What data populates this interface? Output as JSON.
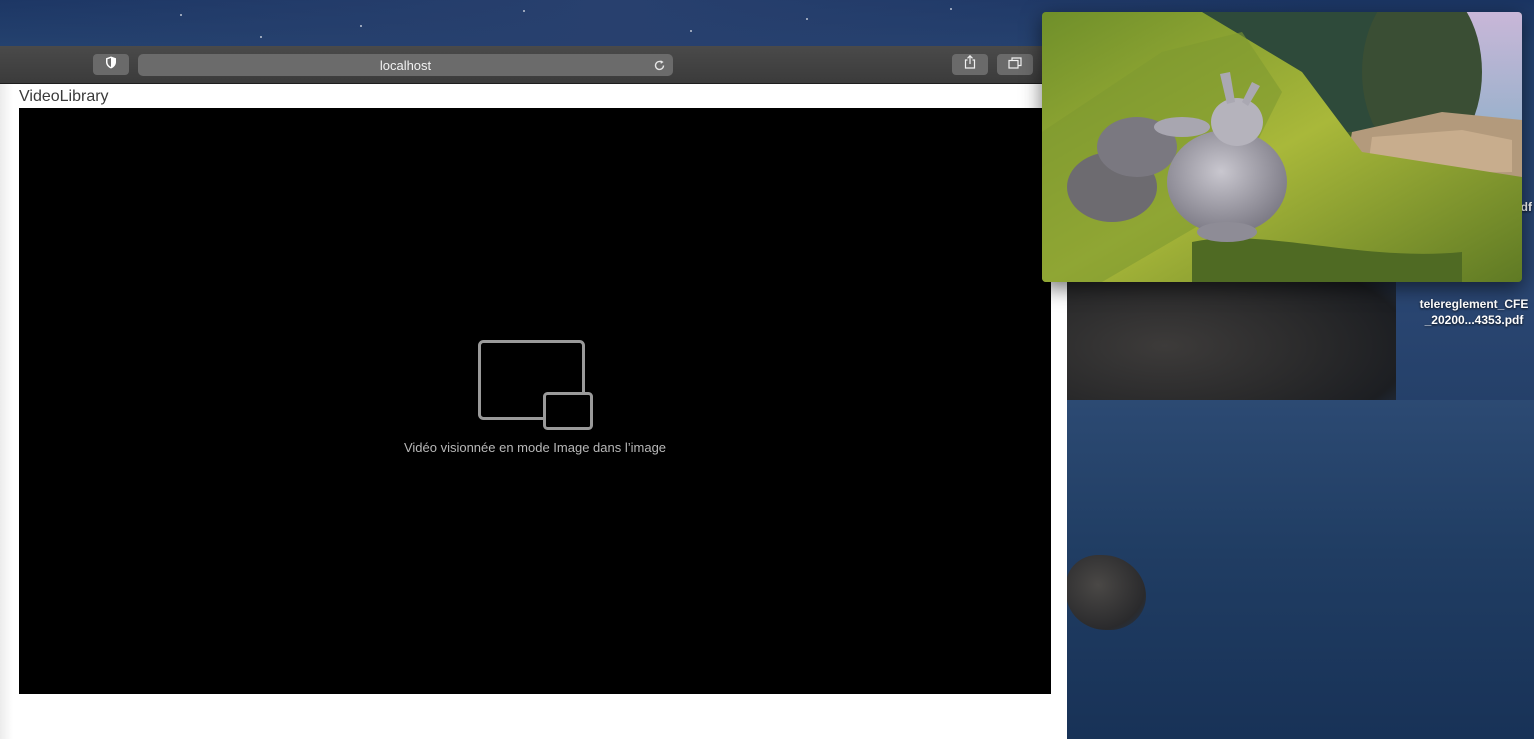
{
  "browser": {
    "address": "localhost",
    "toolbar_icons": [
      "shield-icon",
      "reload-icon",
      "share-icon",
      "tabs-icon"
    ]
  },
  "page": {
    "app_title": "VideoLibrary",
    "video": {
      "pip_message": "Vidéo visionnée en mode Image dans l’image",
      "placeholder_icon": "picture-in-picture-icon"
    }
  },
  "desktop": {
    "files": [
      {
        "name_line1": "telereglement_CFE",
        "name_line2": "_20200...4353.pdf"
      },
      {
        "name_line1": "df"
      }
    ]
  },
  "colors": {
    "toolbar": "#3b3b3b",
    "video_bg": "#000000",
    "pip_message": "#b8b8b8"
  }
}
